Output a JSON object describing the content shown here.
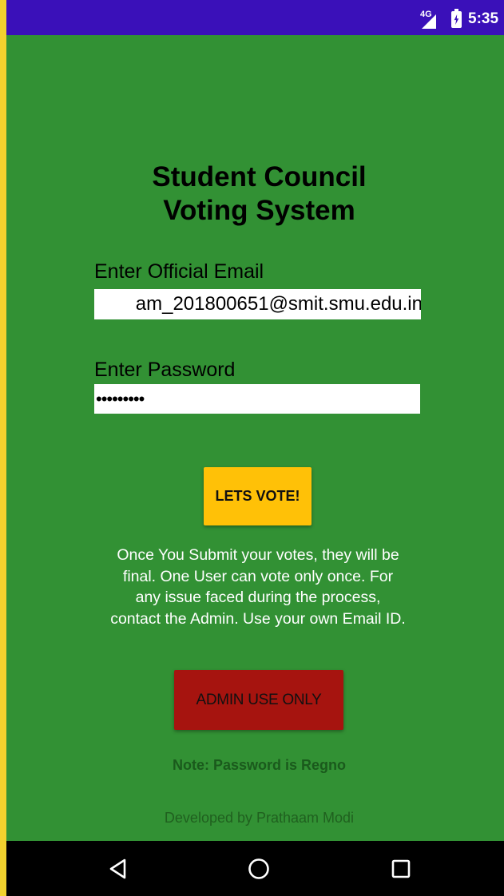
{
  "status_bar": {
    "network": "4G",
    "time": "5:35",
    "icons": [
      "signal-icon",
      "battery-charging-icon"
    ]
  },
  "app": {
    "title_line1": "Student Council",
    "title_line2": "Voting System",
    "email_label": "Enter Official Email",
    "email_value": "am_201800651@smit.smu.edu.in",
    "password_label": "Enter Password",
    "password_value": "•••••••••",
    "vote_button_label": "LETS VOTE!",
    "info_text": "Once You Submit your votes, they will be final.  One User can vote only once. For any issue faced during the process, contact the Admin. Use your own Email ID.",
    "admin_button_label": "ADMIN USE ONLY",
    "note_text": "Note: Password is Regno",
    "developer_text": "Developed by Prathaam Modi"
  },
  "navigation_bar": {
    "icons": [
      "back-icon",
      "home-icon",
      "recent-apps-icon"
    ]
  },
  "colors": {
    "frame_border": "#f2d22e",
    "status_bar": "#3a10b9",
    "background": "#329134",
    "vote_button": "#ffc107",
    "admin_button": "#a6140f",
    "note_text": "#1a5a1c",
    "nav_bar": "#000000"
  }
}
